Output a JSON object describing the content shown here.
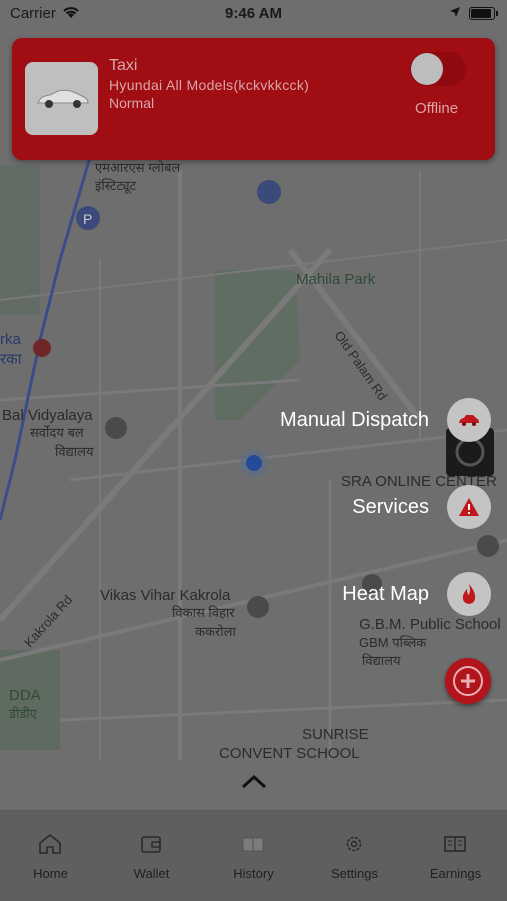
{
  "status_bar": {
    "carrier": "Carrier",
    "time": "9:46 AM"
  },
  "map": {
    "labels": {
      "ms_global_1": "एमआरएस ग्लोबल",
      "ms_global_2": "इंस्टिट्यूट",
      "mahila_park": "Mahila Park",
      "old_palam_rd": "Old Palam Rd",
      "bal_vidyalaya": "Bal Vidyalaya",
      "sarvodaya_1": "सर्वोदय बल",
      "sarvodaya_2": "विद्यालय",
      "sra_online": "SRA ONLINE CENTER",
      "vikas_vihar": "Vikas Vihar Kakrola",
      "vikas_vihar_hi_1": "विकास विहार",
      "vikas_vihar_hi_2": "ककरोला",
      "kakrola_rd": "Kakrola Rd",
      "gbm_school": "G.B.M. Public School",
      "gbm_hi_1": "GBM पब्लिक",
      "gbm_hi_2": "विद्यालय",
      "dda": "DDA",
      "dda_hi": "डीडीए",
      "sunrise_1": "SUNRISE",
      "sunrise_2": "CONVENT SCHOOL",
      "rka": "rka",
      "rka_hi": "रका"
    }
  },
  "vehicle_card": {
    "title": "Taxi",
    "model": "Hyundai All Models(kckvkkcck)",
    "tier": "Normal",
    "status_label": "Offline",
    "online": false
  },
  "fab_menu": {
    "items": [
      {
        "label": "Manual Dispatch",
        "icon": "car-icon"
      },
      {
        "label": "Services",
        "icon": "warning-icon"
      },
      {
        "label": "Heat Map",
        "icon": "flame-icon"
      }
    ],
    "main_icon": "plus-icon",
    "accent": "#c0161c"
  },
  "tabs": [
    {
      "label": "Home",
      "icon": "home-icon"
    },
    {
      "label": "Wallet",
      "icon": "wallet-icon"
    },
    {
      "label": "History",
      "icon": "book-icon"
    },
    {
      "label": "Settings",
      "icon": "gear-icon"
    },
    {
      "label": "Earnings",
      "icon": "ledger-icon"
    }
  ],
  "colors": {
    "card": "#a00d12",
    "overlay": "#6b6b6b"
  }
}
